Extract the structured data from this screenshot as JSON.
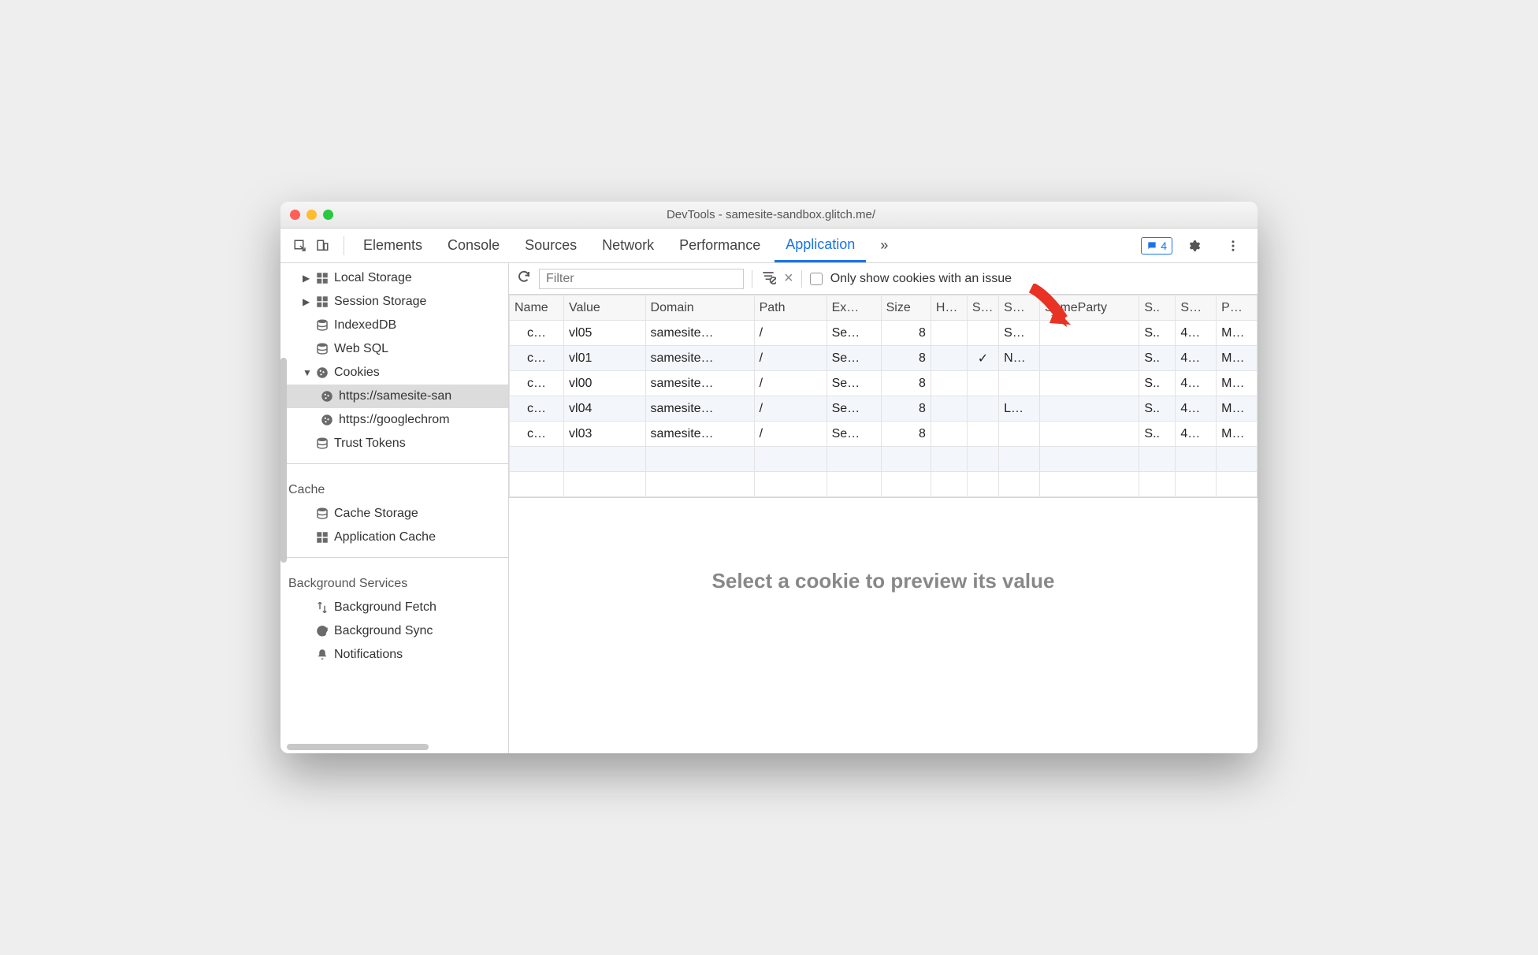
{
  "window": {
    "title": "DevTools - samesite-sandbox.glitch.me/"
  },
  "tabs": {
    "items": [
      "Elements",
      "Console",
      "Sources",
      "Network",
      "Performance",
      "Application"
    ],
    "active": "Application",
    "issues_count": "4"
  },
  "sidebar": {
    "storage": {
      "local": "Local Storage",
      "session": "Session Storage",
      "indexeddb": "IndexedDB",
      "websql": "Web SQL",
      "cookies": "Cookies",
      "cookie_sites": [
        "https://samesite-san",
        "https://googlechrom"
      ],
      "trust_tokens": "Trust Tokens"
    },
    "cache": {
      "header": "Cache",
      "cache_storage": "Cache Storage",
      "app_cache": "Application Cache"
    },
    "bg": {
      "header": "Background Services",
      "fetch": "Background Fetch",
      "sync": "Background Sync",
      "notifications": "Notifications"
    }
  },
  "toolbar": {
    "filter_placeholder": "Filter",
    "only_issues_label": "Only show cookies with an issue"
  },
  "table": {
    "headers": [
      "Name",
      "Value",
      "Domain",
      "Path",
      "Ex…",
      "Size",
      "H…",
      "S…",
      "S…",
      "SameParty",
      "S..",
      "S…",
      "P…"
    ],
    "rows": [
      {
        "name": "c…",
        "value": "vl05",
        "domain": "samesite…",
        "path": "/",
        "exp": "Se…",
        "size": "8",
        "h": "",
        "s1": "",
        "s2": "S…",
        "sp": "",
        "c1": "S..",
        "c2": "4…",
        "c3": "M…"
      },
      {
        "name": "c…",
        "value": "vl01",
        "domain": "samesite…",
        "path": "/",
        "exp": "Se…",
        "size": "8",
        "h": "",
        "s1": "✓",
        "s2": "N…",
        "sp": "",
        "c1": "S..",
        "c2": "4…",
        "c3": "M…"
      },
      {
        "name": "c…",
        "value": "vl00",
        "domain": "samesite…",
        "path": "/",
        "exp": "Se…",
        "size": "8",
        "h": "",
        "s1": "",
        "s2": "",
        "sp": "",
        "c1": "S..",
        "c2": "4…",
        "c3": "M…"
      },
      {
        "name": "c…",
        "value": "vl04",
        "domain": "samesite…",
        "path": "/",
        "exp": "Se…",
        "size": "8",
        "h": "",
        "s1": "",
        "s2": "L…",
        "sp": "",
        "c1": "S..",
        "c2": "4…",
        "c3": "M…"
      },
      {
        "name": "c…",
        "value": "vl03",
        "domain": "samesite…",
        "path": "/",
        "exp": "Se…",
        "size": "8",
        "h": "",
        "s1": "",
        "s2": "",
        "sp": "",
        "c1": "S..",
        "c2": "4…",
        "c3": "M…"
      }
    ]
  },
  "preview": {
    "empty_text": "Select a cookie to preview its value"
  }
}
